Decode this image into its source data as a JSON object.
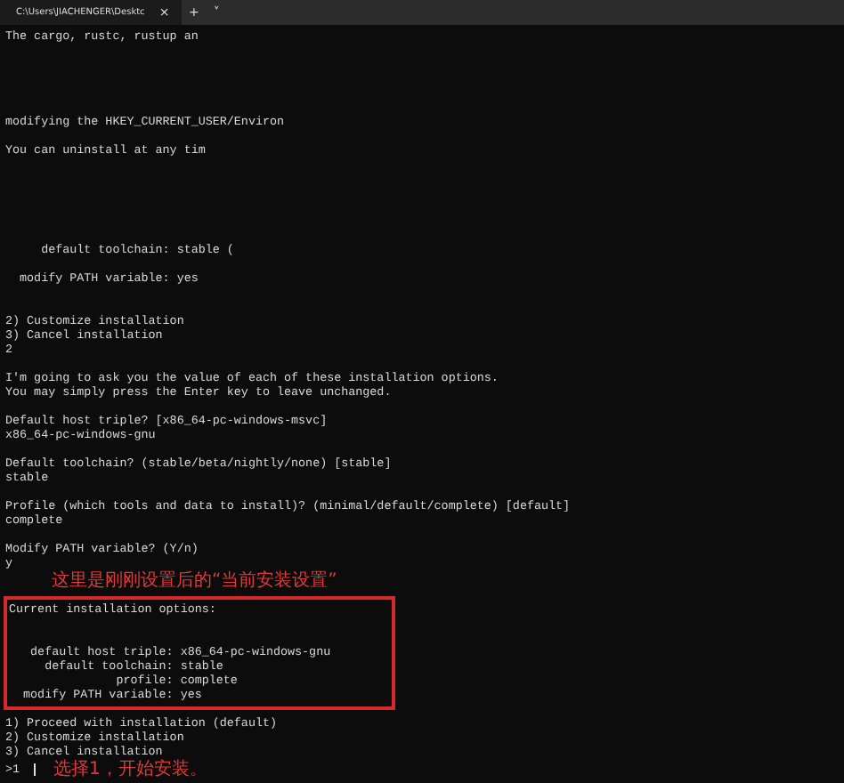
{
  "title_bar": {
    "tab_title": "C:\\Users\\JIACHENGER\\Desktc",
    "close": "×",
    "new_tab": "+",
    "dropdown": "˅"
  },
  "terminal": {
    "lines_before": [
      {
        "kind": "text",
        "text": "The cargo, rustc, rustup an"
      },
      {
        "kind": "blank"
      },
      {
        "kind": "blank"
      },
      {
        "kind": "blank"
      },
      {
        "kind": "blank"
      },
      {
        "kind": "blank"
      },
      {
        "kind": "text",
        "text": "modifying the HKEY_CURRENT_USER/Environ"
      },
      {
        "kind": "blank"
      },
      {
        "kind": "text",
        "text": "You can uninstall at any tim"
      },
      {
        "kind": "blank"
      },
      {
        "kind": "blank"
      },
      {
        "kind": "blank"
      },
      {
        "kind": "blank"
      },
      {
        "kind": "blank"
      },
      {
        "kind": "blank"
      },
      {
        "kind": "text",
        "text": "     default toolchain: stable ("
      },
      {
        "kind": "blank"
      },
      {
        "kind": "text",
        "text": "  modify PATH variable: yes"
      },
      {
        "kind": "blank"
      },
      {
        "kind": "blank"
      },
      {
        "kind": "text",
        "text": "2) Customize installation"
      },
      {
        "kind": "text",
        "text": "3) Cancel installation"
      },
      {
        "kind": "text",
        "text": "2"
      },
      {
        "kind": "blank"
      },
      {
        "kind": "text",
        "text": "I'm going to ask you the value of each of these installation options."
      },
      {
        "kind": "text",
        "text": "You may simply press the Enter key to leave unchanged."
      },
      {
        "kind": "blank"
      },
      {
        "kind": "text",
        "text": "Default host triple? [x86_64-pc-windows-msvc]"
      },
      {
        "kind": "text",
        "text": "x86_64-pc-windows-gnu"
      },
      {
        "kind": "blank"
      },
      {
        "kind": "text",
        "text": "Default toolchain? (stable/beta/nightly/none) [stable]"
      },
      {
        "kind": "text",
        "text": "stable"
      },
      {
        "kind": "blank"
      },
      {
        "kind": "text",
        "text": "Profile (which tools and data to install)? (minimal/default/complete) [default]"
      },
      {
        "kind": "text",
        "text": "complete"
      },
      {
        "kind": "blank"
      },
      {
        "kind": "text",
        "text": "Modify PATH variable? (Y/n)"
      },
      {
        "kind": "text",
        "text": "y"
      }
    ],
    "note": "这里是刚刚设置后的“当前安装设置”",
    "highlighted_lines": [
      {
        "kind": "text",
        "text": "Current installation options:"
      },
      {
        "kind": "blank"
      },
      {
        "kind": "blank"
      },
      {
        "kind": "text",
        "text": "   default host triple: x86_64-pc-windows-gnu"
      },
      {
        "kind": "text",
        "text": "     default toolchain: stable"
      },
      {
        "kind": "text",
        "text": "               profile: complete"
      },
      {
        "kind": "text",
        "text": "  modify PATH variable: yes"
      }
    ],
    "lines_after": [
      {
        "kind": "text",
        "text": "1) Proceed with installation (default)"
      },
      {
        "kind": "text",
        "text": "2) Customize installation"
      },
      {
        "kind": "text",
        "text": "3) Cancel installation"
      }
    ],
    "prompt": {
      "text": ">1",
      "note": "选择1，开始安装。"
    }
  }
}
